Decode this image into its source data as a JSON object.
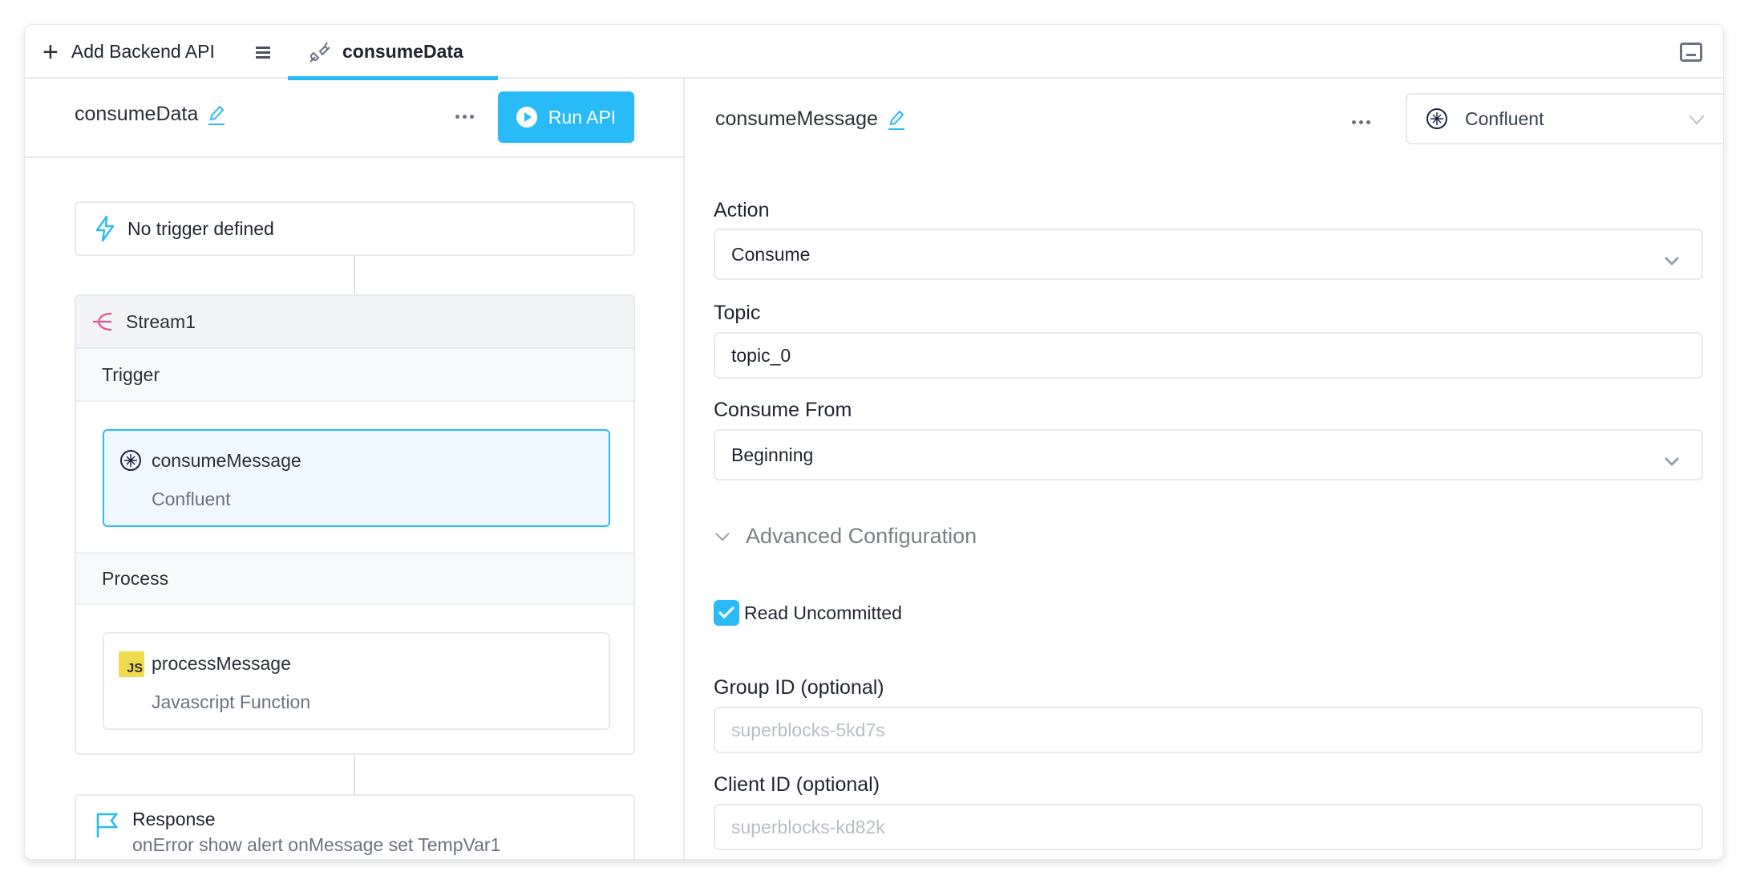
{
  "tabbar": {
    "add_label": "Add Backend API",
    "active_tab": "consumeData"
  },
  "api": {
    "name": "consumeData",
    "run_label": "Run API"
  },
  "flow": {
    "trigger_text": "No trigger defined",
    "stream": {
      "name": "Stream1",
      "trigger_section": "Trigger",
      "trigger_step": {
        "name": "consumeMessage",
        "type": "Confluent"
      },
      "process_section": "Process",
      "process_step": {
        "name": "processMessage",
        "type": "Javascript Function",
        "badge": "JS"
      }
    },
    "response": {
      "title": "Response",
      "detail": "onError show alert onMessage set TempVar1"
    }
  },
  "step_config": {
    "name": "consumeMessage",
    "integration": "Confluent",
    "action_label": "Action",
    "action_value": "Consume",
    "topic_label": "Topic",
    "topic_value": "topic_0",
    "consume_from_label": "Consume From",
    "consume_from_value": "Beginning",
    "advanced_label": "Advanced Configuration",
    "read_uncommitted_label": "Read Uncommitted",
    "read_uncommitted_checked": true,
    "group_id_label": "Group ID (optional)",
    "group_id_placeholder": "superblocks-5kd7s",
    "client_id_label": "Client ID (optional)",
    "client_id_placeholder": "superblocks-kd82k"
  },
  "colors": {
    "accent": "#29bbf7",
    "stream_icon": "#f0508f",
    "js_badge": "#f0db4f"
  }
}
